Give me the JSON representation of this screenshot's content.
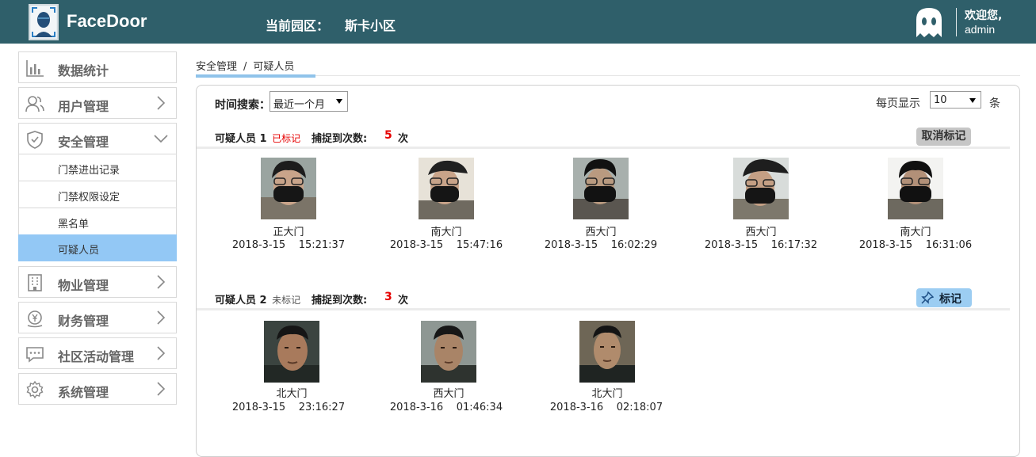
{
  "header": {
    "app_name": "FaceDoor",
    "park_label": "当前园区：",
    "park_name": "斯卡小区",
    "welcome": "欢迎您,",
    "username": "admin",
    "bg_color": "#2f5f6a"
  },
  "sidebar": {
    "items": [
      {
        "label": "数据统计",
        "icon": "bar-chart-icon"
      },
      {
        "label": "用户管理",
        "icon": "users-icon"
      },
      {
        "label": "安全管理",
        "icon": "shield-icon",
        "expanded": true
      },
      {
        "label": "物业管理",
        "icon": "building-icon"
      },
      {
        "label": "财务管理",
        "icon": "money-icon"
      },
      {
        "label": "社区活动管理",
        "icon": "chat-icon"
      },
      {
        "label": "系统管理",
        "icon": "gear-icon"
      }
    ],
    "sub_items": [
      {
        "label": "门禁进出记录"
      },
      {
        "label": "门禁权限设定"
      },
      {
        "label": "黑名单"
      },
      {
        "label": "可疑人员",
        "active": true
      }
    ],
    "active_color": "#93c8f5"
  },
  "breadcrumb": {
    "parent": "安全管理",
    "separator": "/",
    "current": "可疑人员"
  },
  "filters": {
    "time_label": "时间搜索：",
    "time_value": "最近一个月",
    "per_page_label": "每页显示",
    "per_page_value": "10",
    "per_page_unit": "条"
  },
  "groups": [
    {
      "title": "可疑人员 1",
      "status": "已标记",
      "count_label": "捕捉到次数:",
      "count": "5",
      "count_unit": "次",
      "action": "取消标记",
      "captures": [
        {
          "gate": "正大门",
          "date": "2018-3-15",
          "time": "15:21:37"
        },
        {
          "gate": "南大门",
          "date": "2018-3-15",
          "time": "15:47:16"
        },
        {
          "gate": "西大门",
          "date": "2018-3-15",
          "time": "16:02:29"
        },
        {
          "gate": "西大门",
          "date": "2018-3-15",
          "time": "16:17:32"
        },
        {
          "gate": "南大门",
          "date": "2018-3-15",
          "time": "16:31:06"
        }
      ]
    },
    {
      "title": "可疑人员 2",
      "status": "未标记",
      "count_label": "捕捉到次数:",
      "count": "3",
      "count_unit": "次",
      "action": "标记",
      "captures": [
        {
          "gate": "北大门",
          "date": "2018-3-15",
          "time": "23:16:27"
        },
        {
          "gate": "西大门",
          "date": "2018-3-16",
          "time": "01:46:34"
        },
        {
          "gate": "北大门",
          "date": "2018-3-16",
          "time": "02:18:07"
        }
      ]
    }
  ]
}
